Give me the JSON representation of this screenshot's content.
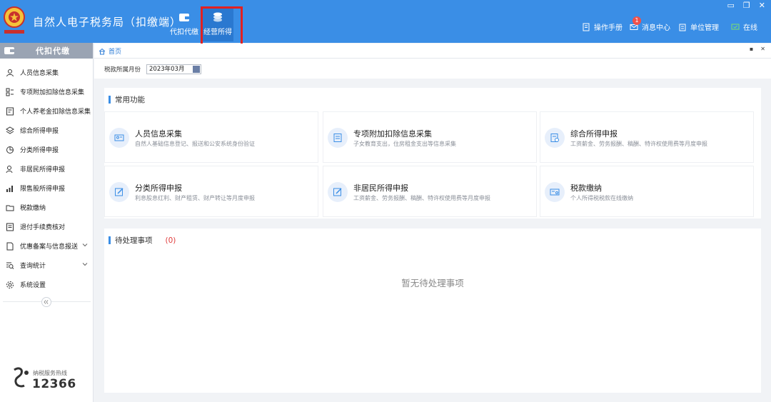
{
  "header": {
    "title": "自然人电子税务局（扣缴端）",
    "modules": [
      {
        "label": "代扣代缴",
        "icon": "wallet-icon"
      },
      {
        "label": "经营所得",
        "icon": "coins-icon"
      }
    ],
    "right": {
      "manual": "操作手册",
      "messages": "消息中心",
      "message_count": "1",
      "unit": "单位管理",
      "online": "在线"
    },
    "window_controls": {
      "minimize": "▭",
      "restore": "❐",
      "close": "✕"
    }
  },
  "sidebar": {
    "title": "代扣代缴",
    "items": [
      {
        "label": "人员信息采集",
        "icon": "person-icon"
      },
      {
        "label": "专项附加扣除信息采集",
        "icon": "list-icon"
      },
      {
        "label": "个人养老金扣除信息采集",
        "icon": "pension-icon"
      },
      {
        "label": "综合所得申报",
        "icon": "layers-icon"
      },
      {
        "label": "分类所得申报",
        "icon": "pie-icon"
      },
      {
        "label": "非居民所得申报",
        "icon": "person-outline-icon"
      },
      {
        "label": "限售股所得申报",
        "icon": "bar-chart-icon"
      },
      {
        "label": "税款缴纳",
        "icon": "folder-icon"
      },
      {
        "label": "退付手续费核对",
        "icon": "document-icon"
      },
      {
        "label": "优惠备案与信息报送",
        "icon": "file-icon"
      },
      {
        "label": "查询统计",
        "icon": "search-list-icon"
      },
      {
        "label": "系统设置",
        "icon": "gear-icon"
      }
    ],
    "hotline_label": "纳税服务热线",
    "hotline_number": "12366"
  },
  "tab": {
    "label": "首页"
  },
  "filter": {
    "label": "税款所属月份",
    "value": "2023年03月"
  },
  "common": {
    "title": "常用功能",
    "cards": [
      {
        "title": "人员信息采集",
        "desc": "自然人基础信息登记、报送和公安系统身份验证",
        "icon": "id-card-icon"
      },
      {
        "title": "专项附加扣除信息采集",
        "desc": "子女教育支出，住房租金支出等信息采集",
        "icon": "deduction-icon"
      },
      {
        "title": "综合所得申报",
        "desc": "工资薪金、劳务报酬、稿酬、特许权使用费等月度申报",
        "icon": "report-icon"
      },
      {
        "title": "分类所得申报",
        "desc": "利息股息红利、财产租赁、财产转让等月度申报",
        "icon": "edit-icon"
      },
      {
        "title": "非居民所得申报",
        "desc": "工资薪金、劳务报酬、稿酬、特许权使用费等月度申报",
        "icon": "edit-icon"
      },
      {
        "title": "税款缴纳",
        "desc": "个人所得税税款在线缴纳",
        "icon": "payment-icon"
      }
    ]
  },
  "pending": {
    "title": "待处理事项",
    "count": "(0)",
    "empty": "暂无待处理事项"
  }
}
